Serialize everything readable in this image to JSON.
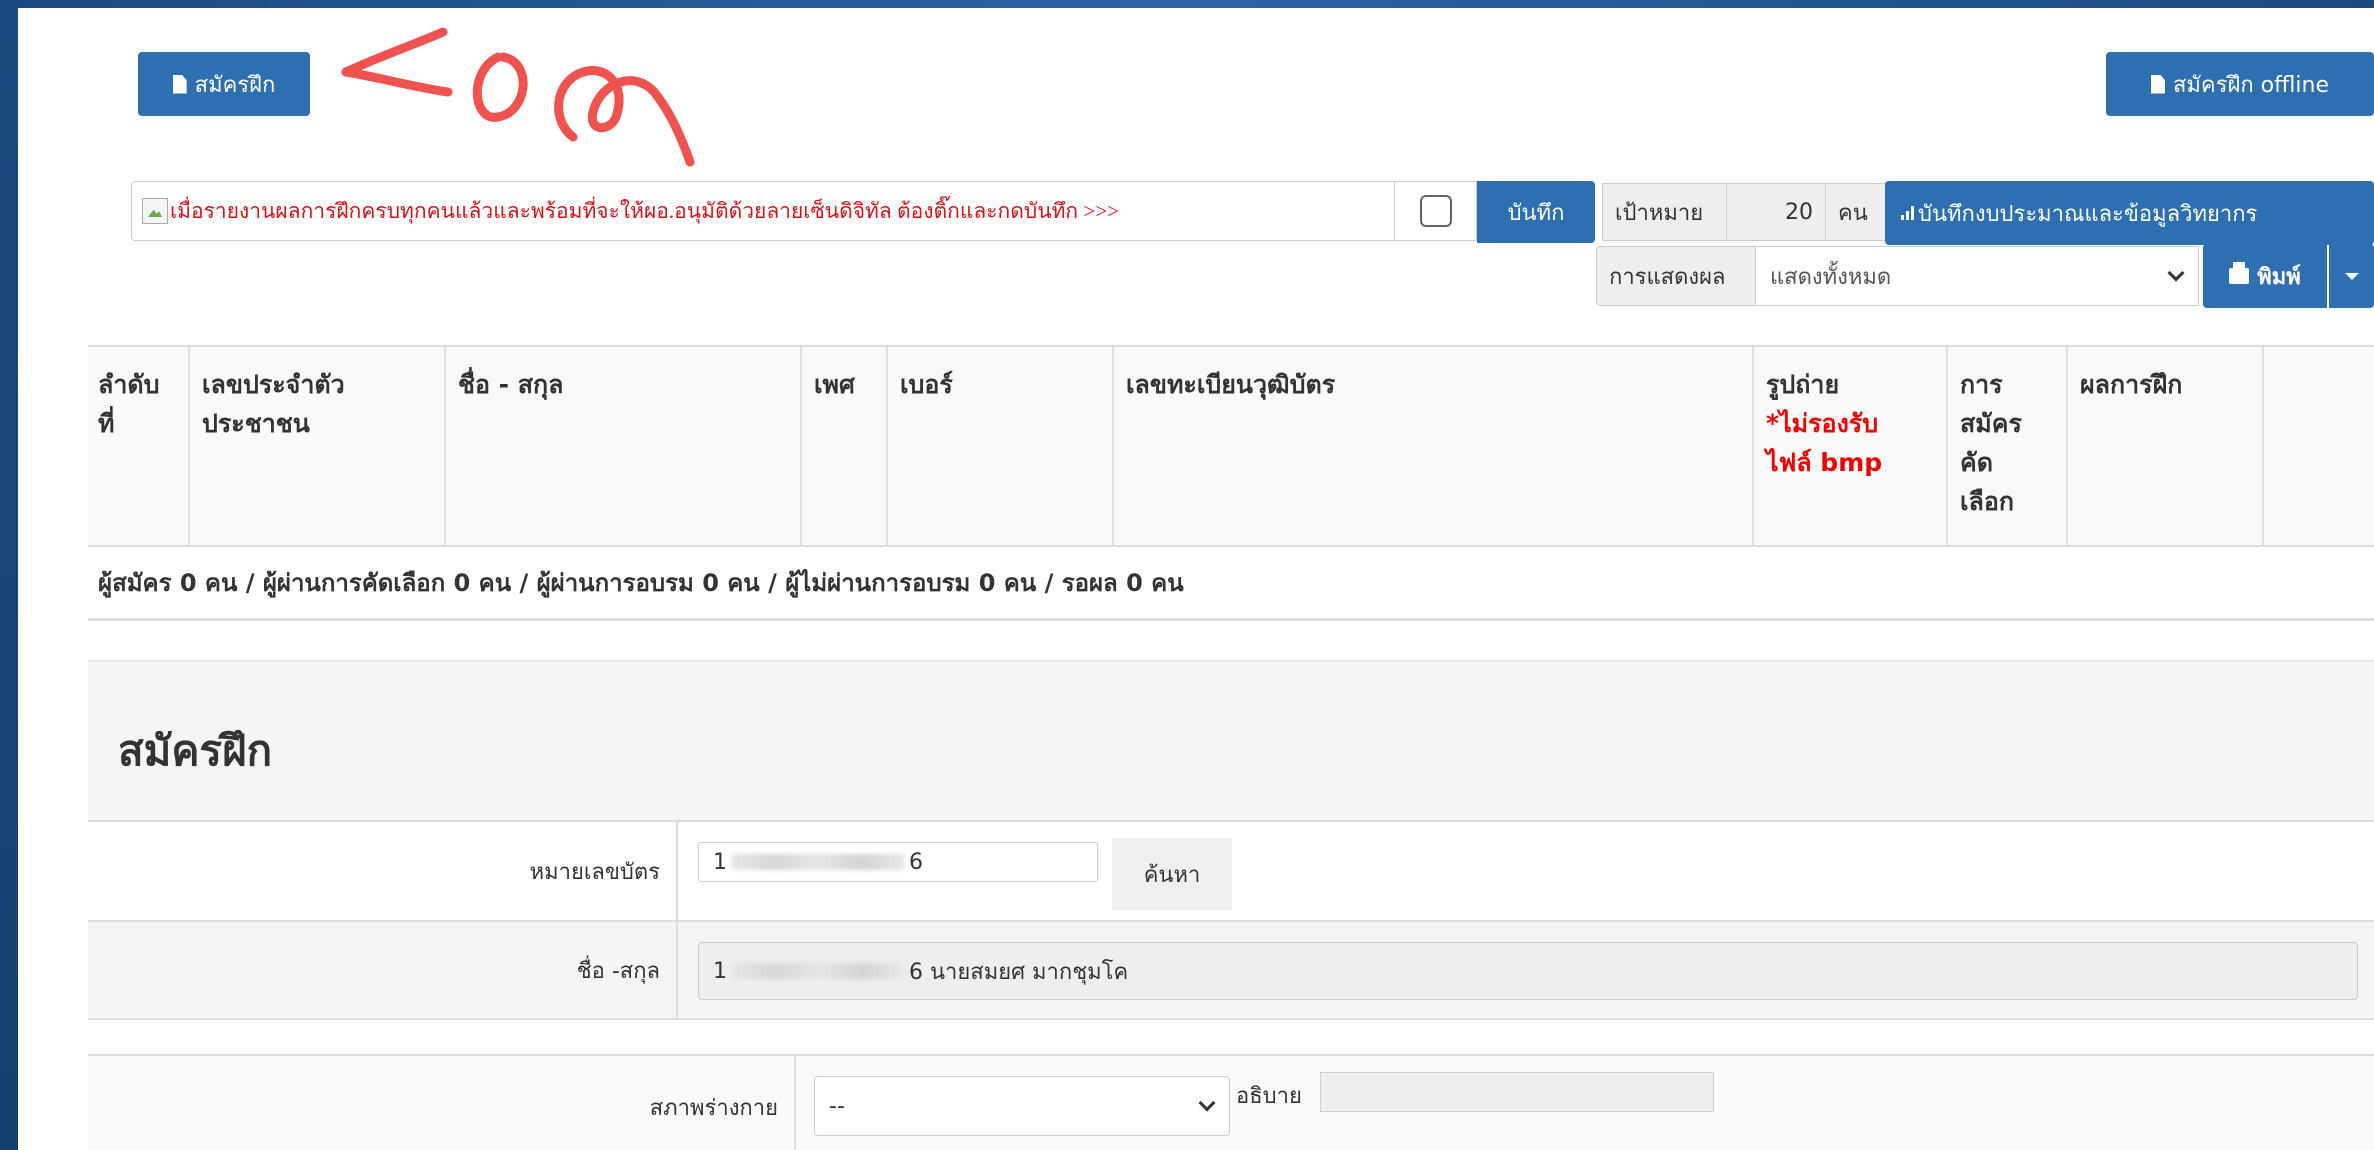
{
  "toolbar": {
    "register_label": "สมัครฝึก",
    "register_offline_label": "สมัครฝึก offline"
  },
  "confirm": {
    "text": "เมื่อรายงานผลการฝึกครบทุกคนแล้วและพร้อมที่จะให้ผอ.อนุมัติด้วยลายเซ็นดิจิทัล ต้องติ๊กและกดบันทึก >>>",
    "checked": false,
    "save_label": "บันทึก"
  },
  "target": {
    "label": "เป้าหมาย",
    "value": "20",
    "unit": "คน"
  },
  "budget_button_label": "บันทึกงบประมาณและข้อมูลวิทยากร",
  "display": {
    "label": "การแสดงผล",
    "selected": "แสดงทั้งหมด"
  },
  "print_label": "พิมพ์",
  "table": {
    "headers": {
      "order": "ลำดับ ที่",
      "id": "เลขประจำตัว ประชาชน",
      "name": "ชื่อ - สกุล",
      "gender": "เพศ",
      "phone": "เบอร์",
      "cert": "เลขทะเบียนวุฒิบัตร",
      "photo": "รูปถ่าย",
      "photo_note": "*ไม่รองรับ ไฟล์ bmp",
      "selection": "การ สมัคร คัด เลือก",
      "result": "ผลการฝึก"
    },
    "summary": "ผู้สมัคร 0 คน / ผู้ผ่านการคัดเลือก 0 คน / ผู้ผ่านการอบรม 0 คน / ผู้ไม่ผ่านการอบรม 0 คน / รอผล 0 คน"
  },
  "form": {
    "title": "สมัครฝึก",
    "card_label": "หมายเลขบัตร",
    "card_value_prefix": "1",
    "card_value_suffix": "6",
    "search_label": "ค้นหา",
    "name_label": "ชื่อ -สกุล",
    "name_value_prefix": "1",
    "name_value_suffix": "6 นายสมยศ มากชุมโค",
    "physical_label": "สภาพร่างกาย",
    "physical_selected": "--",
    "explain_label": "อธิบาย",
    "explain_value": ""
  },
  "colors": {
    "primary": "#2d6fb1",
    "warning_text": "#d3141a",
    "annotation": "#ef5350"
  }
}
